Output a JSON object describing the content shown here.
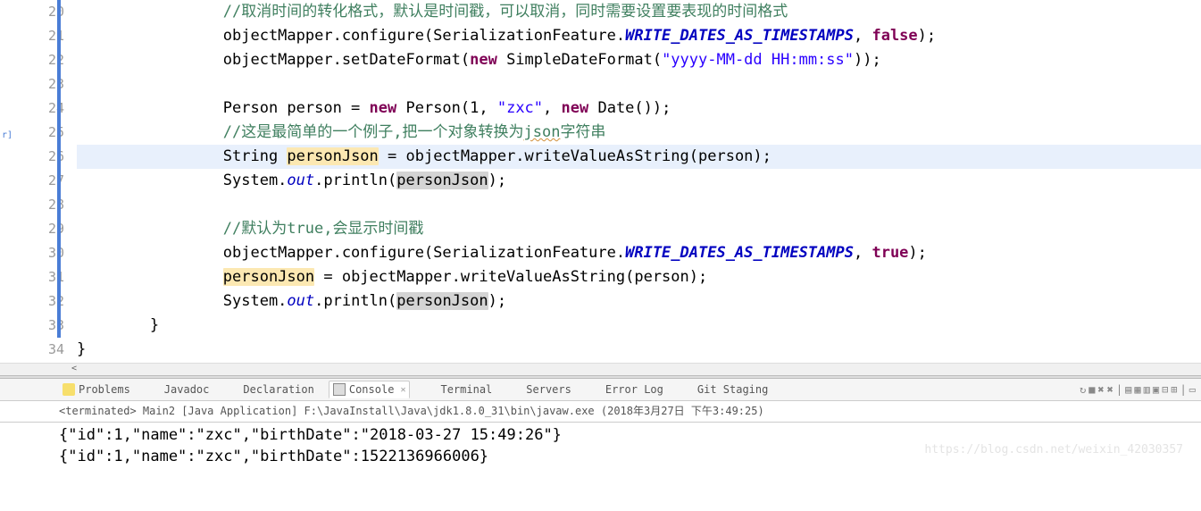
{
  "left_label": "r]",
  "lines": [
    {
      "n": 20,
      "tokens": [
        [
          "        ",
          "p"
        ],
        [
          "//取消时间的转化格式，默认是时间戳，可以取消，同时需要设置要表现的时间格式",
          "c-comment"
        ]
      ]
    },
    {
      "n": 21,
      "tokens": [
        [
          "        ",
          "p"
        ],
        [
          "objectMapper.configure(SerializationFeature.",
          "p"
        ],
        [
          "WRITE_DATES_AS_TIMESTAMPS",
          "c-staticf"
        ],
        [
          ", ",
          "p"
        ],
        [
          "false",
          "c-kw"
        ],
        [
          ");",
          "p"
        ]
      ]
    },
    {
      "n": 22,
      "tokens": [
        [
          "        ",
          "p"
        ],
        [
          "objectMapper.setDateFormat(",
          "p"
        ],
        [
          "new",
          "c-kw"
        ],
        [
          " SimpleDateFormat(",
          "p"
        ],
        [
          "\"yyyy-MM-dd HH:mm:ss\"",
          "c-str"
        ],
        [
          "));",
          "p"
        ]
      ]
    },
    {
      "n": 23,
      "tokens": [
        [
          " ",
          "p"
        ]
      ]
    },
    {
      "n": 24,
      "tokens": [
        [
          "        ",
          "p"
        ],
        [
          "Person person = ",
          "p"
        ],
        [
          "new",
          "c-kw"
        ],
        [
          " Person(1, ",
          "p"
        ],
        [
          "\"zxc\"",
          "c-str"
        ],
        [
          ", ",
          "p"
        ],
        [
          "new",
          "c-kw"
        ],
        [
          " Date());",
          "p"
        ]
      ]
    },
    {
      "n": 25,
      "tokens": [
        [
          "        ",
          "p"
        ],
        [
          "//这是最简单的一个例子,把一个对象转换为",
          "c-comment"
        ],
        [
          "json",
          "c-comment wavy"
        ],
        [
          "字符串",
          "c-comment"
        ]
      ]
    },
    {
      "n": 26,
      "hl": true,
      "tokens": [
        [
          "        ",
          "p"
        ],
        [
          "String ",
          "p"
        ],
        [
          "personJson",
          "hl-orange"
        ],
        [
          " = objectMapper.writeValueAsString(person);",
          "p"
        ]
      ]
    },
    {
      "n": 27,
      "tokens": [
        [
          "        ",
          "p"
        ],
        [
          "System.",
          "p"
        ],
        [
          "out",
          "c-static"
        ],
        [
          ".println(",
          "p"
        ],
        [
          "personJson",
          "hl-grey"
        ],
        [
          ");",
          "p"
        ]
      ]
    },
    {
      "n": 28,
      "tokens": [
        [
          " ",
          "p"
        ]
      ]
    },
    {
      "n": 29,
      "tokens": [
        [
          "        ",
          "p"
        ],
        [
          "//默认为",
          "c-comment"
        ],
        [
          "true,",
          "c-comment"
        ],
        [
          "会显示时间戳",
          "c-comment"
        ]
      ]
    },
    {
      "n": 30,
      "tokens": [
        [
          "        ",
          "p"
        ],
        [
          "objectMapper.configure(SerializationFeature.",
          "p"
        ],
        [
          "WRITE_DATES_AS_TIMESTAMPS",
          "c-staticf"
        ],
        [
          ", ",
          "p"
        ],
        [
          "true",
          "c-kw"
        ],
        [
          ");",
          "p"
        ]
      ]
    },
    {
      "n": 31,
      "tokens": [
        [
          "        ",
          "p"
        ],
        [
          "personJson",
          "hl-orange"
        ],
        [
          " = objectMapper.writeValueAsString(person);",
          "p"
        ]
      ]
    },
    {
      "n": 32,
      "tokens": [
        [
          "        ",
          "p"
        ],
        [
          "System.",
          "p"
        ],
        [
          "out",
          "c-static"
        ],
        [
          ".println(",
          "p"
        ],
        [
          "personJson",
          "hl-grey"
        ],
        [
          ");",
          "p"
        ]
      ]
    },
    {
      "n": 33,
      "tokens": [
        [
          "    }",
          "p"
        ]
      ]
    },
    {
      "n": 34,
      "tokens": [
        [
          "}",
          "p"
        ]
      ]
    }
  ],
  "views": [
    {
      "name": "Problems",
      "icon": "icon-problems"
    },
    {
      "name": "Javadoc",
      "icon": "icon-javadoc"
    },
    {
      "name": "Declaration",
      "icon": "icon-decl"
    },
    {
      "name": "Console",
      "icon": "icon-console",
      "active": true,
      "close": true
    },
    {
      "name": "Terminal",
      "icon": "icon-terminal"
    },
    {
      "name": "Servers",
      "icon": "icon-servers"
    },
    {
      "name": "Error Log",
      "icon": "icon-error"
    },
    {
      "name": "Git Staging",
      "icon": "icon-git"
    }
  ],
  "terminated": "<terminated> Main2 [Java Application] F:\\JavaInstall\\Java\\jdk1.8.0_31\\bin\\javaw.exe (2018年3月27日 下午3:49:25)",
  "console_lines": [
    "{\"id\":1,\"name\":\"zxc\",\"birthDate\":\"2018-03-27 15:49:26\"}",
    "{\"id\":1,\"name\":\"zxc\",\"birthDate\":1522136966006}"
  ],
  "watermark": "https://blog.csdn.net/weixin_42030357",
  "tool_icons": [
    "↻",
    "■",
    "✖",
    "✖",
    "|",
    "▤",
    "▦",
    "▥",
    "▣",
    "⊟",
    "⊞",
    "|",
    "▭"
  ]
}
